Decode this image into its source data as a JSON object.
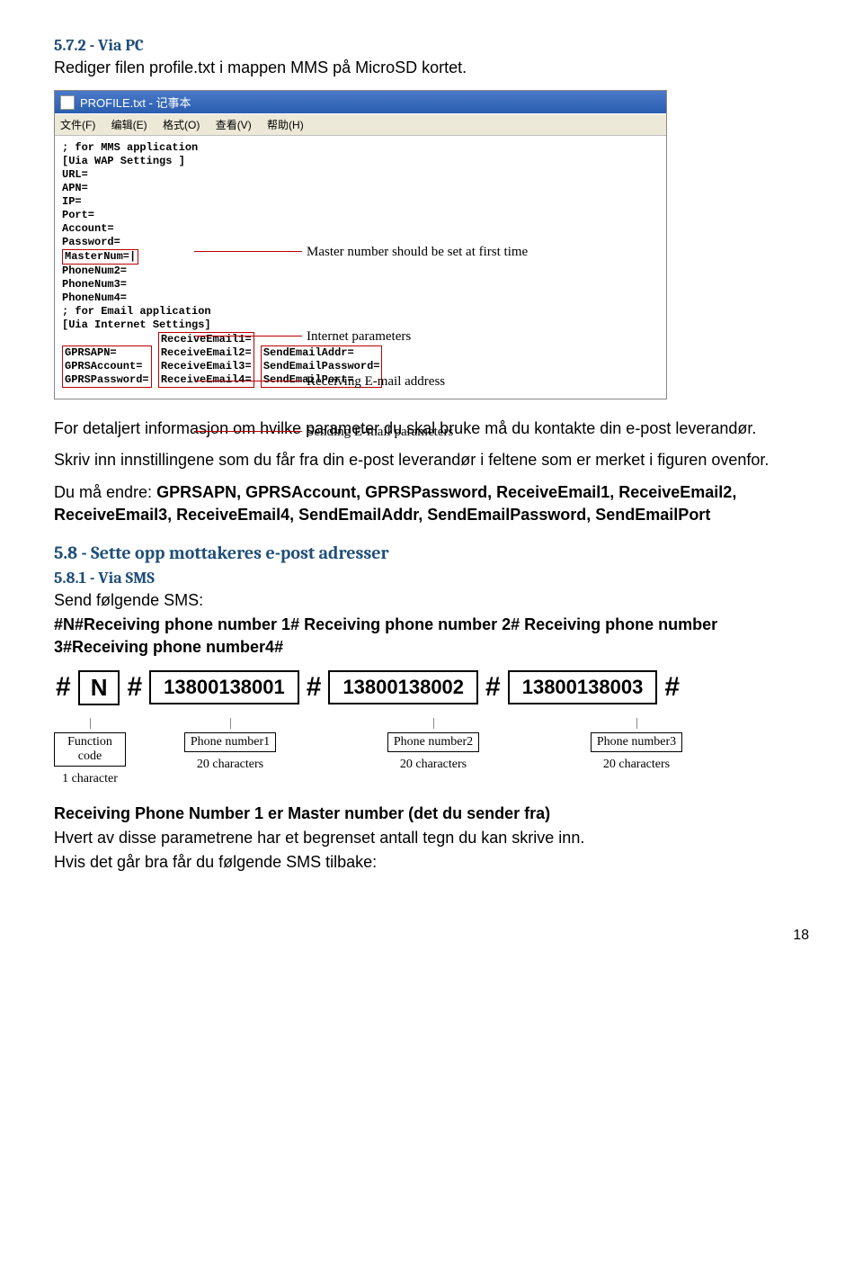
{
  "section572": {
    "heading": "5.7.2 - Via PC",
    "intro": "Rediger filen profile.txt i mappen MMS på MicroSD kortet."
  },
  "notepad": {
    "title": "PROFILE.txt - 记事本",
    "menu": [
      "文件(F)",
      "编辑(E)",
      "格式(O)",
      "查看(V)",
      "帮助(H)"
    ],
    "lines": [
      "; for MMS application",
      "[Uia WAP Settings ]",
      "URL=",
      "APN=",
      "IP=",
      "Port=",
      "Account=",
      "Password="
    ],
    "group_master": [
      "MasterNum=|"
    ],
    "lines2": [
      "PhoneNum2=",
      "PhoneNum3=",
      "PhoneNum4=",
      "; for Email application",
      "[Uia Internet Settings]"
    ],
    "group_gprs": [
      "GPRSAPN=",
      "GPRSAccount=",
      "GPRSPassword="
    ],
    "group_recv": [
      "ReceiveEmail1=",
      "ReceiveEmail2=",
      "ReceiveEmail3=",
      "ReceiveEmail4="
    ],
    "group_send": [
      "SendEmailAddr=",
      "SendEmailPassword=",
      "SendEmailPort="
    ],
    "annot": {
      "master": "Master number should be set at first time",
      "internet": "Internet parameters",
      "recv": "Receiving E-mail address",
      "send": "Sending E-mail parameters"
    }
  },
  "para1": "For detaljert informasjon om hvilke parameter du skal bruke må du kontakte din e-post leverandør.",
  "para2": "Skriv inn innstillingene som du får fra din e-post leverandør i feltene som er merket i figuren ovenfor.",
  "para3_prefix": "Du må endre: ",
  "para3_bold": "GPRSAPN, GPRSAccount, GPRSPassword, ReceiveEmail1, ReceiveEmail2, ReceiveEmail3, ReceiveEmail4, SendEmailAddr, SendEmailPassword, SendEmailPort",
  "section58": {
    "heading": "5.8 - Sette opp mottakeres e-post adresser"
  },
  "section581": {
    "heading": "5.8.1 - Via SMS",
    "line1": "Send følgende SMS:",
    "line2": "#N#Receiving phone number 1# Receiving phone number 2# Receiving phone number 3#Receiving phone number4#"
  },
  "sms": {
    "n": "N",
    "p1": "13800138001",
    "p2": "13800138002",
    "p3": "13800138003",
    "func_label": "Function code",
    "func_chars": "1 character",
    "pn1_label": "Phone number1",
    "pn2_label": "Phone number2",
    "pn3_label": "Phone number3",
    "chars20": "20 characters"
  },
  "para4": "Receiving Phone Number 1 er Master number (det du sender fra)",
  "para5": "Hvert av disse parametrene har et begrenset antall tegn du kan skrive inn.",
  "para6": "Hvis det går bra får du følgende SMS tilbake:",
  "page": "18"
}
